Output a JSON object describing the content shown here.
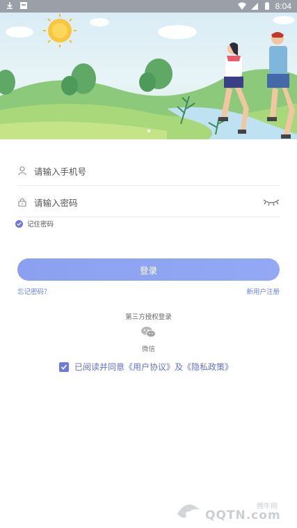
{
  "status_bar": {
    "time": "8:04",
    "icons": [
      "download-icon",
      "notification-icon",
      "wifi-icon",
      "signal-icon",
      "battery-icon"
    ]
  },
  "banner": {
    "description_icons": [
      "sun-icon",
      "cloud-icon",
      "tree-icon",
      "runner-icon"
    ],
    "pager_dots": 1
  },
  "form": {
    "phone_placeholder": "请输入手机号",
    "password_placeholder": "请输入密码",
    "remember_label": "记住密码",
    "login_button": "登录",
    "forgot_link": "忘记密码？",
    "register_link": "新用户注册"
  },
  "third_party": {
    "title": "第三方授权登录",
    "wechat_label": "微信"
  },
  "agreement": {
    "text": "已阅读并同意《用户协议》及《隐私政策》"
  },
  "watermark": {
    "site_cn": "腾牛网",
    "site_en": "QQTN.com"
  },
  "colors": {
    "accent": "#6e7bdc",
    "button_start": "#8ba0f0",
    "button_end": "#93a9f4",
    "link": "#6680d8",
    "status_bar": "#9b9fa7"
  }
}
